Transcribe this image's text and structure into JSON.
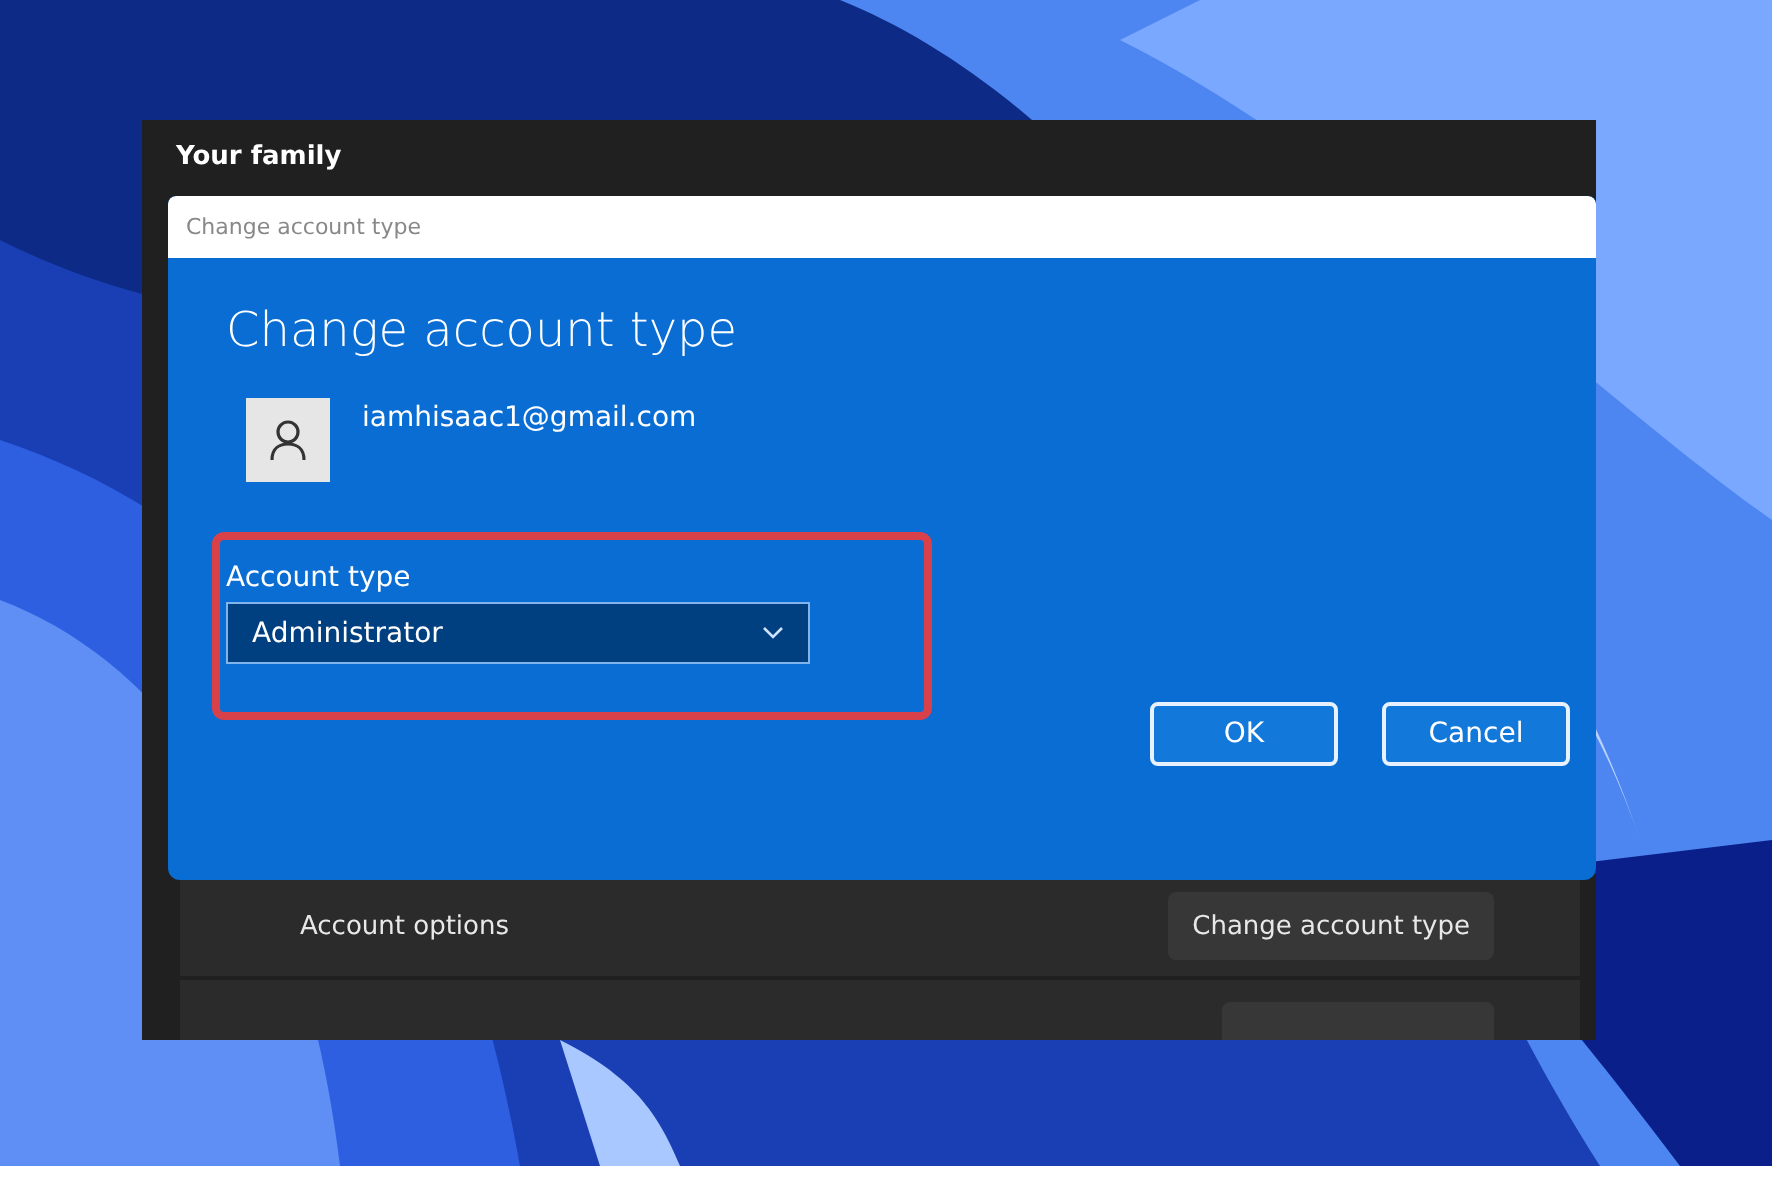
{
  "window": {
    "title": "Your family"
  },
  "dialog": {
    "title_bar": "Change account type",
    "heading": "Change account type",
    "email": "iamhisaac1@gmail.com",
    "field_label": "Account type",
    "dropdown": {
      "value": "Administrator"
    },
    "buttons": [
      "OK",
      "Cancel"
    ]
  },
  "options": [
    {
      "label": "Account options",
      "button": "Change account type"
    },
    {
      "kind": "partial"
    }
  ]
}
